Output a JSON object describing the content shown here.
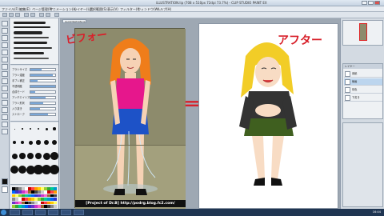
{
  "window": {
    "title": "iLLUSTRATION.lip (708 x 510px 72dpi 73.7%) - CLIP STUDIO PAINT EX"
  },
  "menu": [
    "ファイル(F)",
    "編集(E)",
    "ページ管理(P)",
    "アニメーション(A)",
    "レイヤー(L)",
    "選択範囲(S)",
    "表示(V)",
    "フィルター(I)",
    "ウィンドウ(W)",
    "ヘルプ(H)"
  ],
  "tab": {
    "label": "ILLUSTRATION.lip"
  },
  "tool_property": {
    "rows": [
      {
        "label": "ブラシサイズ",
        "level": 0.45
      },
      {
        "label": "ブラシ濃度",
        "level": 0.9
      },
      {
        "label": "手ブレ補正",
        "level": 0.3
      },
      {
        "label": "不透明度",
        "level": 1.0
      },
      {
        "label": "合成モード",
        "level": 0.2
      },
      {
        "label": "アンチエイリアス",
        "level": 0.6
      },
      {
        "label": "ブラシ形状",
        "level": 0.5
      },
      {
        "label": "入り抜き",
        "level": 0.4
      },
      {
        "label": "ストローク",
        "level": 0.7
      }
    ]
  },
  "canvas": {
    "before_caption": "[Project of Dr.B]   http://podrg.blog.fc2.com/",
    "before_label": "ビフォー",
    "after_label": "アフター",
    "arrow": "⟹"
  },
  "layers": {
    "header": "レイヤー",
    "rows": [
      {
        "name": "用紙"
      },
      {
        "name": "線画"
      },
      {
        "name": "彩色"
      },
      {
        "name": "下書き"
      }
    ]
  },
  "status": {
    "clock": "16:44"
  },
  "colors": {
    "handwriting": "#d8202a",
    "accent": "#3e8ed6"
  }
}
